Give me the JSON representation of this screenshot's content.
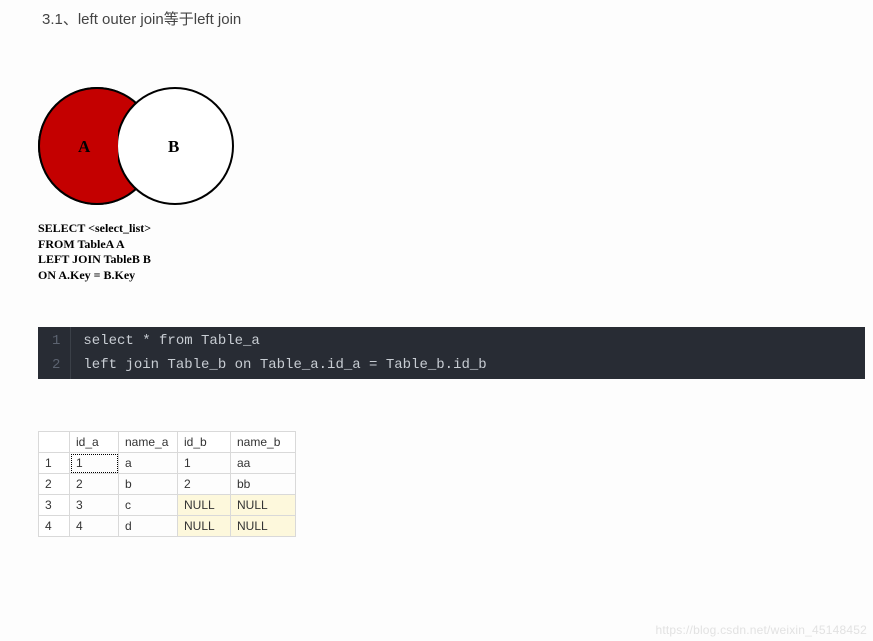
{
  "heading": "3.1、left outer join等于left join",
  "venn": {
    "labelA": "A",
    "labelB": "B",
    "caption": "SELECT <select_list>\nFROM TableA A\nLEFT JOIN TableB B\nON A.Key = B.Key"
  },
  "code": {
    "lines": [
      "select * from Table_a",
      "left join Table_b on Table_a.id_a = Table_b.id_b"
    ]
  },
  "result": {
    "columns": [
      "id_a",
      "name_a",
      "id_b",
      "name_b"
    ],
    "rows": [
      {
        "n": "1",
        "id_a": "1",
        "name_a": "a",
        "id_b": "1",
        "name_b": "aa",
        "null_b": false
      },
      {
        "n": "2",
        "id_a": "2",
        "name_a": "b",
        "id_b": "2",
        "name_b": "bb",
        "null_b": false
      },
      {
        "n": "3",
        "id_a": "3",
        "name_a": "c",
        "id_b": "NULL",
        "name_b": "NULL",
        "null_b": true
      },
      {
        "n": "4",
        "id_a": "4",
        "name_a": "d",
        "id_b": "NULL",
        "name_b": "NULL",
        "null_b": true
      }
    ]
  },
  "watermark": "https://blog.csdn.net/weixin_45148452"
}
